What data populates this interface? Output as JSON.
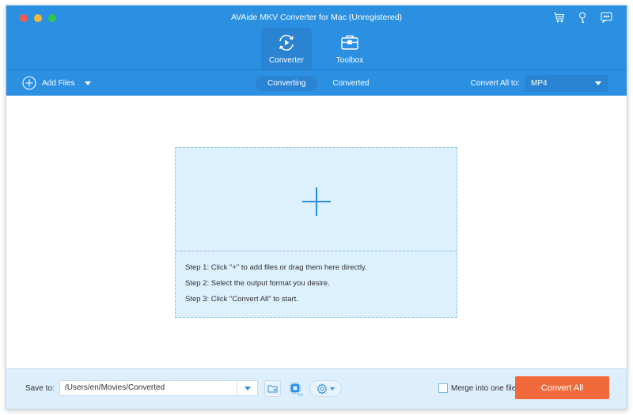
{
  "window": {
    "title": "AVAide MKV Converter for Mac (Unregistered)",
    "traffic_lights": [
      "close",
      "minimize",
      "zoom"
    ]
  },
  "top_icons": [
    {
      "name": "cart-icon",
      "label": "Purchase"
    },
    {
      "name": "key-icon",
      "label": "Register"
    },
    {
      "name": "chat-icon",
      "label": "Feedback"
    }
  ],
  "nav_tabs": [
    {
      "label": "Converter",
      "icon": "converter-icon",
      "active": true
    },
    {
      "label": "Toolbox",
      "icon": "toolbox-icon",
      "active": false
    }
  ],
  "subbar": {
    "add_files_label": "Add Files",
    "tabs": [
      {
        "label": "Converting",
        "active": true
      },
      {
        "label": "Converted",
        "active": false
      }
    ],
    "convert_all_to_label": "Convert All to:",
    "format_value": "MP4"
  },
  "dropzone": {
    "steps": [
      "Step 1: Click \"+\" to add files or drag them here directly.",
      "Step 2: Select the output format you desire.",
      "Step 3: Click \"Convert All\" to start."
    ]
  },
  "footer": {
    "save_to_label": "Save to:",
    "save_path": "/Users/en/Movies/Converted",
    "merge_label": "Merge into one file",
    "merge_checked": false,
    "convert_all_label": "Convert All",
    "hw_accel_badge": "ON"
  },
  "colors": {
    "header_blue": "#2b8fe2",
    "accent_orange": "#f26a3b",
    "dropzone_bg": "#dcf0fd"
  }
}
